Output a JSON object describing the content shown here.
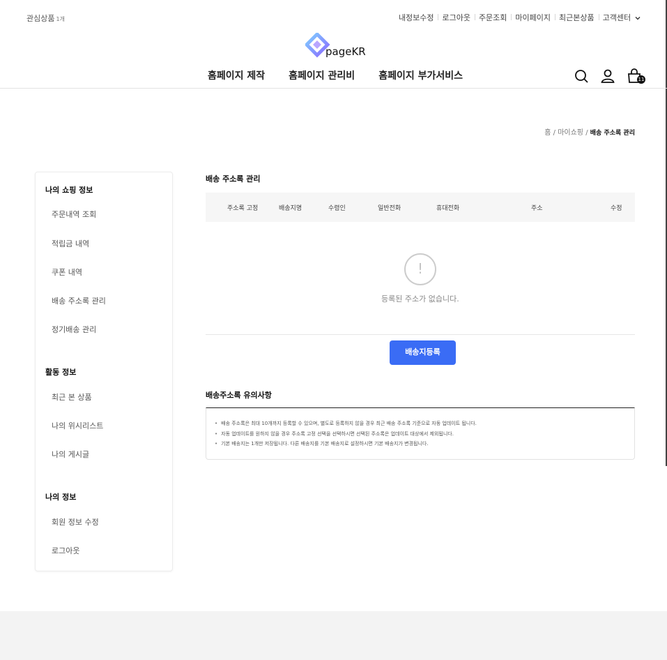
{
  "top": {
    "wish_label": "관심상품",
    "wish_count": "1개",
    "links": [
      "내정보수정",
      "로그아웃",
      "주문조회",
      "마이페이지",
      "최근본상품",
      "고객센터"
    ]
  },
  "logo": {
    "text": "pageKR"
  },
  "gnb": [
    "홈페이지 제작",
    "홈페이지 관리비",
    "홈페이지 부가서비스"
  ],
  "cart": {
    "count": "11"
  },
  "icons": [
    "search-icon",
    "user-icon",
    "cart-icon",
    "chevron-down-icon",
    "exclamation-icon"
  ],
  "breadcrumb": {
    "home": "홈",
    "sep1": "/",
    "parent": "마이쇼핑",
    "sep2": "/",
    "current": "배송 주소록 관리"
  },
  "sidebar": {
    "sections": [
      {
        "title": "나의 쇼핑 정보",
        "items": [
          "주문내역 조회",
          "적립금 내역",
          "쿠폰 내역",
          "배송 주소록 관리",
          "정기배송 관리"
        ]
      },
      {
        "title": "활동 정보",
        "items": [
          "최근 본 상품",
          "나의 위시리스트",
          "나의 게시글"
        ]
      },
      {
        "title": "나의 정보",
        "items": [
          "회원 정보 수정",
          "로그아웃"
        ]
      }
    ]
  },
  "main": {
    "title": "배송 주소록 관리",
    "columns": [
      "주소록 고정",
      "배송지명",
      "수령인",
      "일반전화",
      "휴대전화",
      "주소",
      "수정"
    ],
    "empty_icon": "!",
    "empty_text": "등록된 주소가 없습니다.",
    "add_button": "배송지등록"
  },
  "notice": {
    "title": "배송주소록 유의사항",
    "items": [
      "배송 주소록은 최대 10개까지 등록할 수 있으며, 별도로 등록하지 않을 경우 최근 배송 주소록 기준으로 자동 업데이트 됩니다.",
      "자동 업데이트를 원하지 않을 경우 주소록 고정 선택을 선택하시면 선택된 주소록은 업데이트 대상에서 제외됩니다.",
      "기본 배송지는 1개만 저장됩니다. 다른 배송지를 기본 배송지로 설정하시면 기본 배송지가 변경됩니다."
    ]
  },
  "colors": {
    "accent": "#3a6cf5",
    "table_header_bg": "#f6f6f6",
    "footer_bg": "#f3f3f3"
  }
}
